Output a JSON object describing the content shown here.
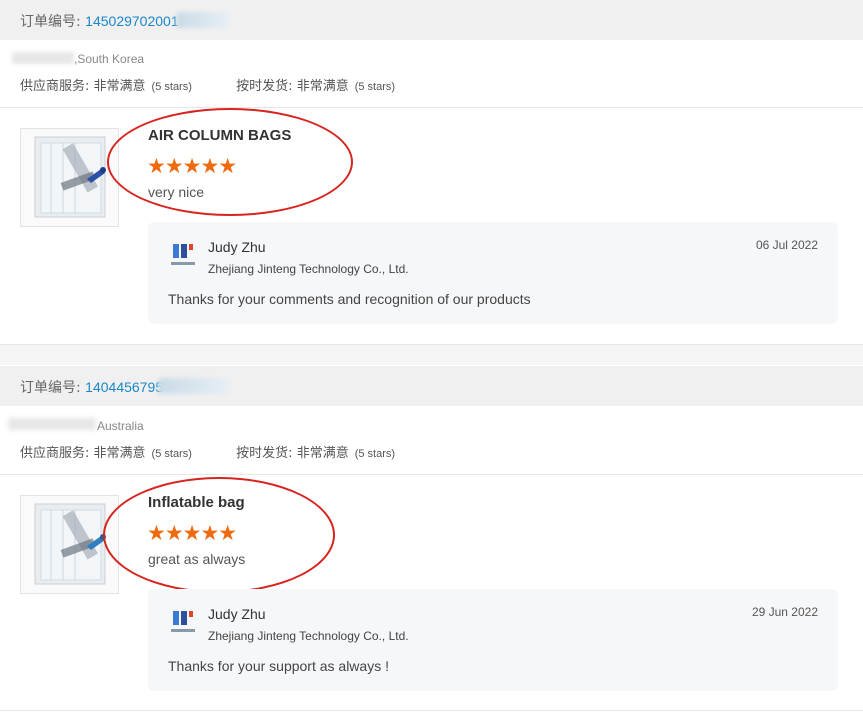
{
  "orders": [
    {
      "order_label": "订单编号:",
      "order_number": "145029702001",
      "country": ",South Korea",
      "ratings": {
        "supplier_label": "供应商服务:",
        "supplier_value": "非常满意",
        "supplier_stars": "(5 stars)",
        "shipping_label": "按时发货:",
        "shipping_value": "非常满意",
        "shipping_stars": "(5 stars)"
      },
      "product_title": "AIR COLUMN BAGS",
      "stars": "★★★★★",
      "star_rating": 5,
      "review": "very nice",
      "reply": {
        "name": "Judy Zhu",
        "company": "Zhejiang Jinteng Technology Co., Ltd.",
        "date": "06 Jul 2022",
        "text": "Thanks for your comments and recognition of our products"
      }
    },
    {
      "order_label": "订单编号:",
      "order_number": "1404456795",
      "country": "Australia",
      "ratings": {
        "supplier_label": "供应商服务:",
        "supplier_value": "非常满意",
        "supplier_stars": "(5 stars)",
        "shipping_label": "按时发货:",
        "shipping_value": "非常满意",
        "shipping_stars": "(5 stars)"
      },
      "product_title": "Inflatable bag",
      "stars": "★★★★★",
      "star_rating": 5,
      "review": "great as always",
      "reply": {
        "name": "Judy Zhu",
        "company": "Zhejiang Jinteng Technology Co., Ltd.",
        "date": "29 Jun 2022",
        "text": "Thanks for your support as always !"
      }
    }
  ],
  "colors": {
    "accent_link": "#1b87c9",
    "star": "#f06a10",
    "annotation": "#d8241e"
  },
  "icons": [
    "product-image",
    "company-logo-icon",
    "star-icon"
  ]
}
